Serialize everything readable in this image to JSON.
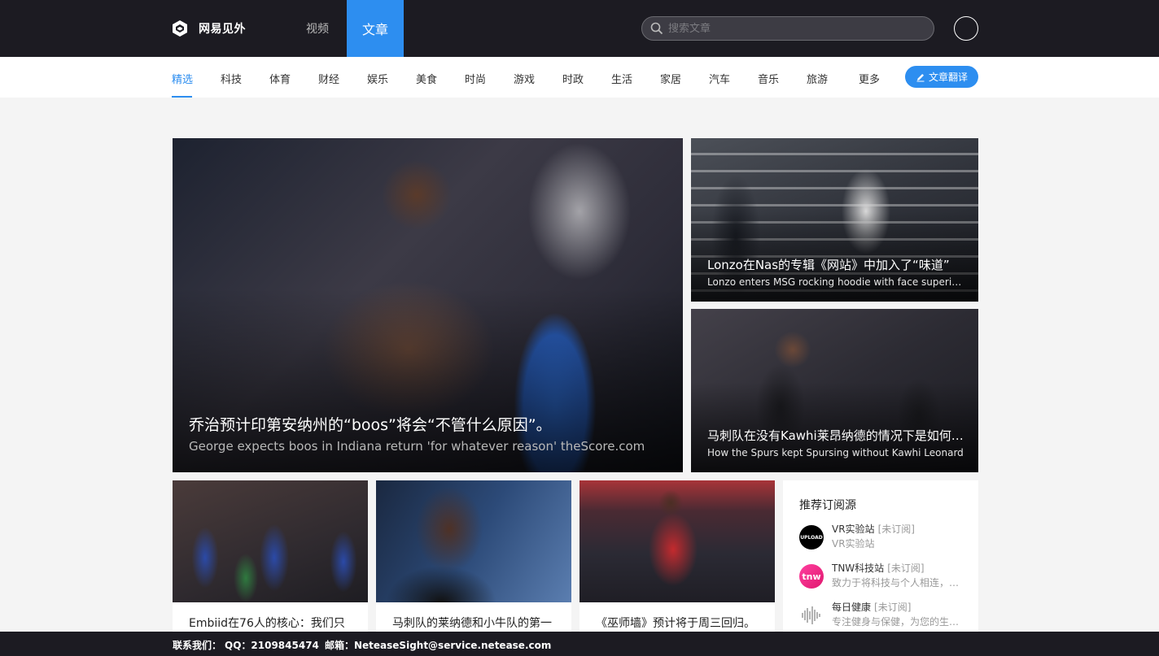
{
  "header": {
    "brand": "网易见外",
    "nav": [
      {
        "label": "视频",
        "active": false
      },
      {
        "label": "文章",
        "active": true
      }
    ],
    "search_placeholder": "搜索文章",
    "accent_color": "#2d8ef0",
    "bg_color": "#1c1b22"
  },
  "categories": [
    {
      "label": "精选",
      "active": true
    },
    {
      "label": "科技"
    },
    {
      "label": "体育"
    },
    {
      "label": "财经"
    },
    {
      "label": "娱乐"
    },
    {
      "label": "美食"
    },
    {
      "label": "时尚"
    },
    {
      "label": "游戏"
    },
    {
      "label": "时政"
    },
    {
      "label": "生活"
    },
    {
      "label": "家居"
    },
    {
      "label": "汽车"
    },
    {
      "label": "音乐"
    },
    {
      "label": "旅游"
    },
    {
      "label": "更多"
    }
  ],
  "translate_button": "文章翻译",
  "featured": {
    "title": "乔治预计印第安纳州的“boos”将会“不管什么原因”。",
    "subtitle": "George expects boos in Indiana return 'for whatever reason' theScore.com"
  },
  "side_articles": [
    {
      "title": "Lonzo在Nas的专辑《网站》中加入了“味道”",
      "subtitle": "Lonzo enters MSG rocking hoodie with face superimposed"
    },
    {
      "title": "马刺队在没有Kawhi莱昂纳德的情况下是如何做到的",
      "subtitle": "How the Spurs kept Spursing without Kawhi Leonard"
    }
  ],
  "small_articles": [
    {
      "title": "Embiid在76人的核心：我们只"
    },
    {
      "title": "马刺队的莱纳德和小牛队的第一"
    },
    {
      "title": "《巫师墙》预计将于周三回归。"
    }
  ],
  "sidebar": {
    "title": "推荐订阅源",
    "sources": [
      {
        "name": "VR实验站",
        "status": "[未订阅]",
        "desc": "VR实验站",
        "logo_text": "UPLOAD",
        "icon": "upload-logo-icon"
      },
      {
        "name": "TNW科技站",
        "status": "[未订阅]",
        "desc": "致力于将科技与个人相连，推动科技发展",
        "logo_text": "tnw",
        "icon": "tnw-logo-icon"
      },
      {
        "name": "每日健康",
        "status": "[未订阅]",
        "desc": "专注健身与保健，为您的生活添色彩",
        "logo_text": "",
        "icon": "health-logo-icon"
      }
    ]
  },
  "footer": {
    "contact": "联系我们：",
    "qq": "QQ：2109845474",
    "email": "邮箱：NeteaseSight@service.netease.com"
  }
}
